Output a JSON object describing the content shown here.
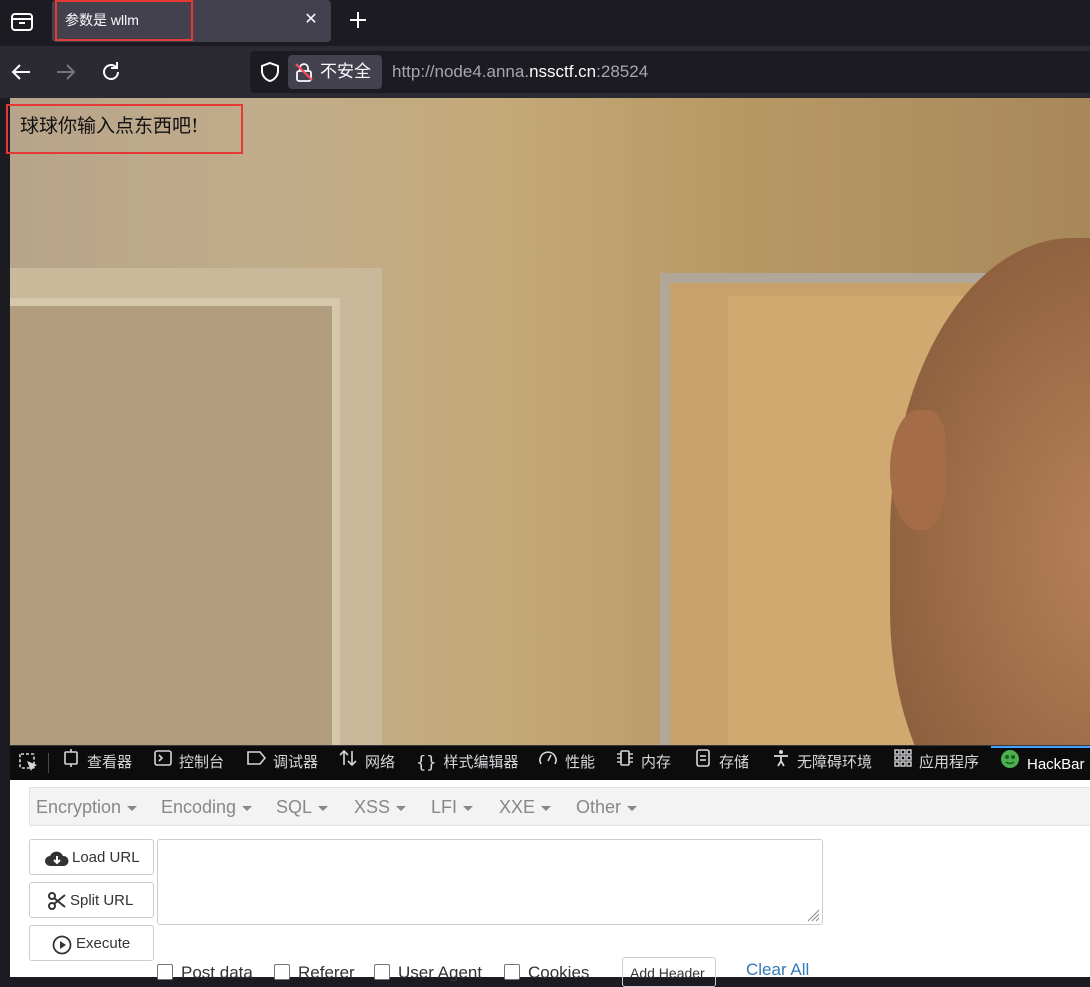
{
  "browser": {
    "tab": {
      "title": "参数是 wllm",
      "close_glyph": "✕"
    },
    "nav": {
      "insecure_label": "不安全",
      "url_scheme": "http://node4.anna.",
      "url_domain": "nssctf.cn",
      "url_port": ":28524"
    }
  },
  "page": {
    "message": "球球你输入点东西吧!"
  },
  "devtools": {
    "tabs": [
      {
        "label": "查看器",
        "icon": "inspector-icon"
      },
      {
        "label": "控制台",
        "icon": "console-icon"
      },
      {
        "label": "调试器",
        "icon": "debugger-icon"
      },
      {
        "label": "网络",
        "icon": "network-icon"
      },
      {
        "label": "样式编辑器",
        "icon": "style-editor-icon"
      },
      {
        "label": "性能",
        "icon": "performance-icon"
      },
      {
        "label": "内存",
        "icon": "memory-icon"
      },
      {
        "label": "存储",
        "icon": "storage-icon"
      },
      {
        "label": "无障碍环境",
        "icon": "accessibility-icon"
      },
      {
        "label": "应用程序",
        "icon": "application-icon"
      },
      {
        "label": "HackBar",
        "icon": "hackbar-icon"
      }
    ]
  },
  "hackbar": {
    "menu": [
      "Encryption",
      "Encoding",
      "SQL",
      "XSS",
      "LFI",
      "XXE",
      "Other"
    ],
    "buttons": {
      "load_url": "Load URL",
      "split_url": "Split URL",
      "execute": "Execute"
    },
    "url_value": "",
    "options": [
      "Post data",
      "Referer",
      "User Agent",
      "Cookies"
    ],
    "add_header": "Add Header",
    "clear_all": "Clear All"
  },
  "colors": {
    "highlight": "#e53935",
    "accent": "#45a1ff",
    "link": "#337ab7"
  }
}
